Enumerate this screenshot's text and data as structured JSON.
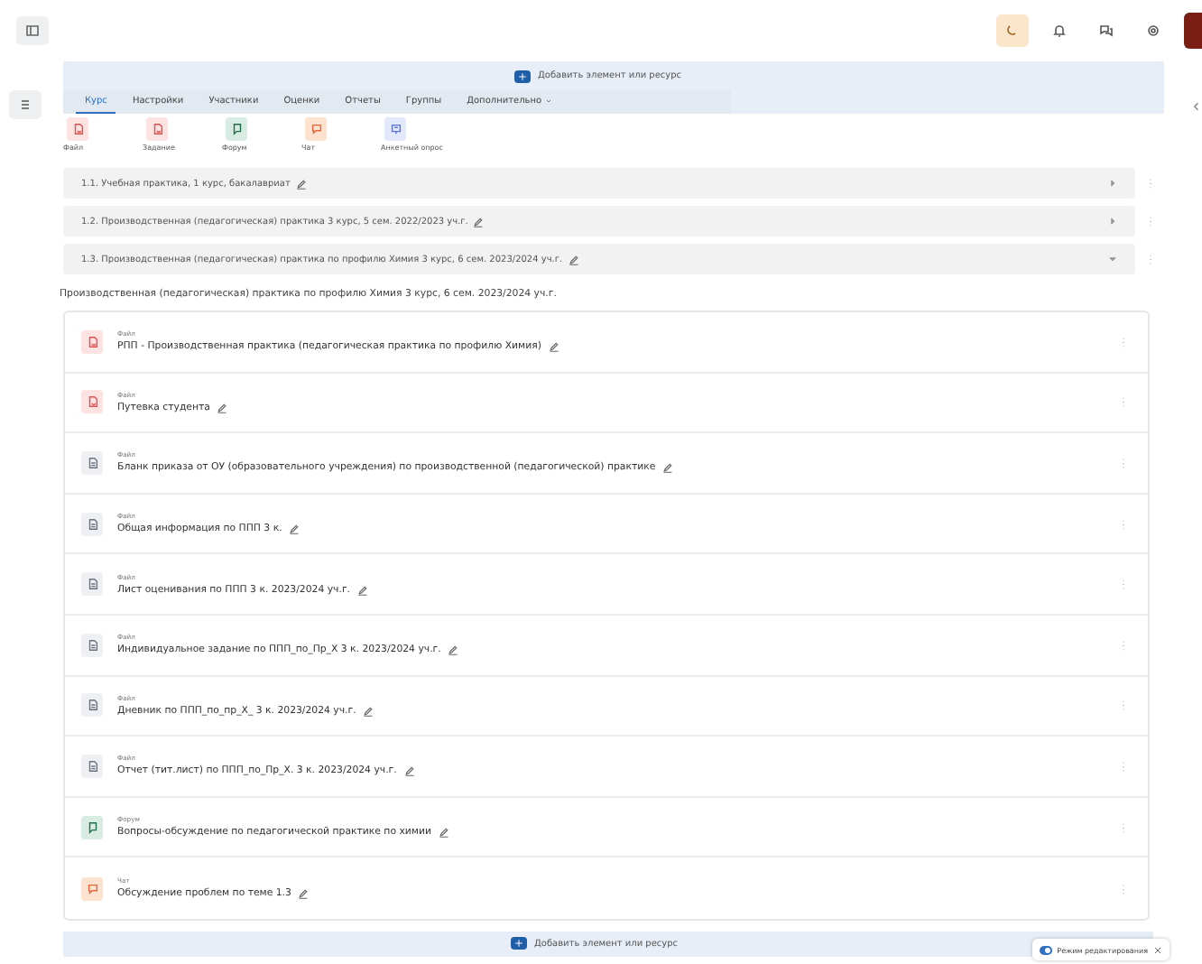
{
  "add_top": "Добавить элемент или ресурс",
  "tabs": [
    {
      "label": "Курс",
      "selected": true
    },
    {
      "label": "Настройки",
      "selected": false
    },
    {
      "label": "Участники",
      "selected": false
    },
    {
      "label": "Оценки",
      "selected": false
    },
    {
      "label": "Отчеты",
      "selected": false
    },
    {
      "label": "Группы",
      "selected": false
    },
    {
      "label": "Дополнительно",
      "selected": false,
      "kind": "menu"
    }
  ],
  "chooser": [
    {
      "label": "Файл",
      "kind": "pdf"
    },
    {
      "label": "Задание",
      "kind": "assign"
    },
    {
      "label": "Форум",
      "kind": "forum"
    },
    {
      "label": "Чат",
      "kind": "chat"
    },
    {
      "label": "Анкетный опрос",
      "kind": "survey"
    }
  ],
  "sections": [
    {
      "title": "1.1. Учебная практика, 1 курс, бакалавриат",
      "expanded": false
    },
    {
      "title": "1.2. Производственная (педагогическая) практика 3 курс, 5 сем. 2022/2023 уч.г.",
      "expanded": false
    },
    {
      "title": "1.3. Производственная (педагогическая) практика по профилю Химия 3 курс, 6 сем. 2023/2024 уч.г.",
      "expanded": true
    }
  ],
  "section_heading": "Производственная (педагогическая) практика по профилю Химия 3 курс, 6 сем. 2023/2024 уч.г.",
  "activities": [
    {
      "kind": "pdf",
      "type_label": "Файл",
      "name": "РПП - Производственная практика (педагогическая практика по профилю Химия)"
    },
    {
      "kind": "pdf",
      "type_label": "Файл",
      "name": "Путевка студента"
    },
    {
      "kind": "doc",
      "type_label": "Файл",
      "name": "Бланк приказа от ОУ (образовательного учреждения) по производственной (педагогической) практике"
    },
    {
      "kind": "doc",
      "type_label": "Файл",
      "name": "Общая информация по ППП 3 к."
    },
    {
      "kind": "doc",
      "type_label": "Файл",
      "name": "Лист оценивания по ППП 3 к. 2023/2024 уч.г."
    },
    {
      "kind": "doc",
      "type_label": "Файл",
      "name": "Индивидуальное задание по ППП_по_Пр_Х 3 к. 2023/2024 уч.г."
    },
    {
      "kind": "doc",
      "type_label": "Файл",
      "name": "Дневник по ППП_по_пр_Х_ 3 к. 2023/2024 уч.г."
    },
    {
      "kind": "doc",
      "type_label": "Файл",
      "name": "Отчет (тит.лист) по ППП_по_Пр_Х. 3 к. 2023/2024 уч.г."
    },
    {
      "kind": "forum",
      "type_label": "Форум",
      "name": "Вопросы-обсуждение по педагогической практике по химии"
    },
    {
      "kind": "chat",
      "type_label": "Чат",
      "name": "Обсуждение проблем по теме 1.3"
    }
  ],
  "add_bottom": "Добавить элемент или ресурс",
  "edit_mode": {
    "label": "Режим редактирования",
    "on": true
  }
}
